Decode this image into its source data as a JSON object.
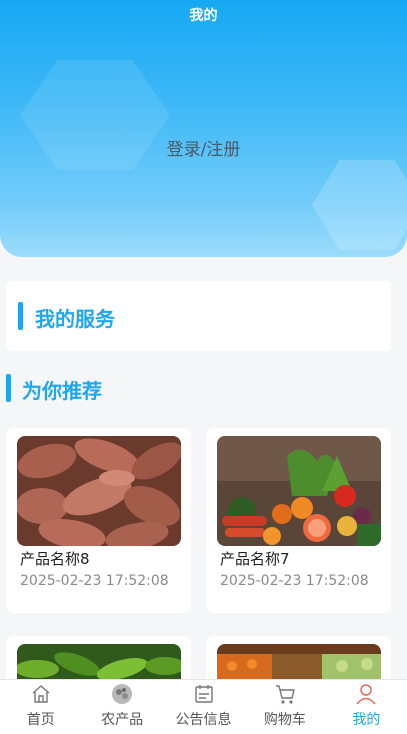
{
  "header": {
    "title": "我的",
    "login_label": "登录/注册"
  },
  "services": {
    "title": "我的服务"
  },
  "recommend": {
    "title": "为你推荐",
    "products": [
      {
        "name": "产品名称8",
        "time": "2025-02-23 17:52:08",
        "image": "sweet-potato"
      },
      {
        "name": "产品名称7",
        "time": "2025-02-23 17:52:08",
        "image": "vegetables"
      },
      {
        "image": "green-peppers"
      },
      {
        "image": "produce-market"
      }
    ]
  },
  "tabbar": {
    "items": [
      {
        "label": "首页",
        "icon": "home-icon"
      },
      {
        "label": "农产品",
        "icon": "produce-icon"
      },
      {
        "label": "公告信息",
        "icon": "notice-icon"
      },
      {
        "label": "购物车",
        "icon": "cart-icon"
      },
      {
        "label": "我的",
        "icon": "user-icon",
        "active": true
      }
    ]
  },
  "colors": {
    "accent": "#1ea7f0",
    "header_top": "#17a8f3",
    "header_bottom": "#9bdcfc"
  }
}
